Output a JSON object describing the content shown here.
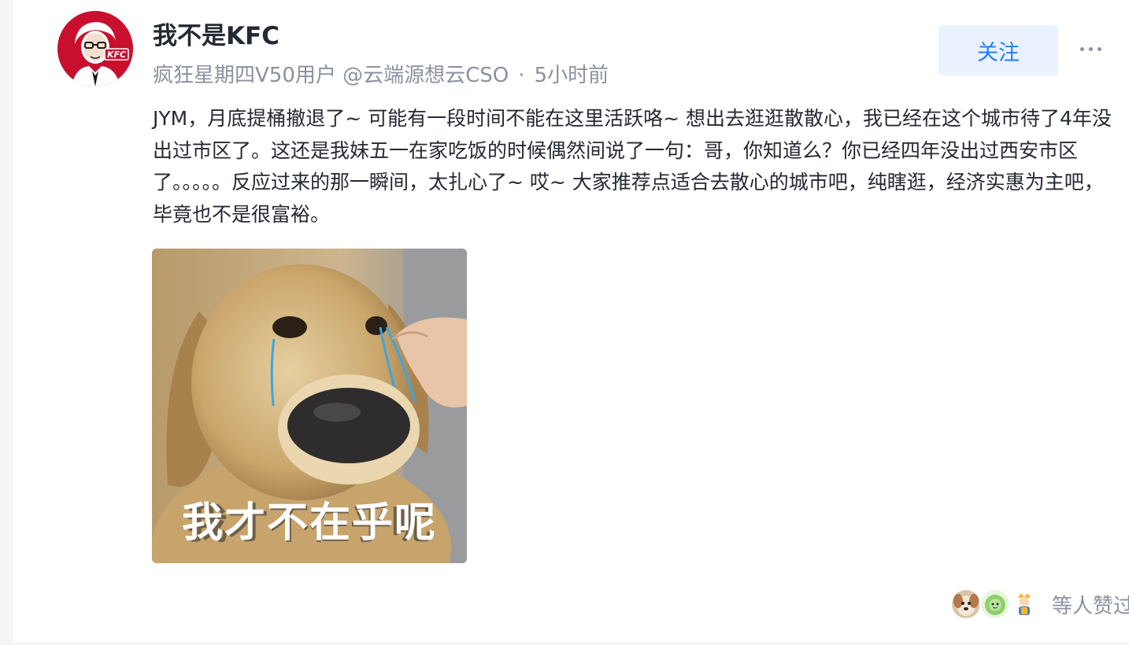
{
  "post": {
    "author": {
      "name": "我不是KFC",
      "avatar_icon": "kfc-logo-avatar",
      "avatar_text": "KFC",
      "title": "疯狂星期四V50用户 @云端源想云CSO",
      "time": "5小时前"
    },
    "follow_label": "关注",
    "more_icon": "more-dots-icon",
    "separator": "·",
    "content": "JYM，月底提桶撤退了~ 可能有一段时间不能在这里活跃咯~ 想出去逛逛散散心，我已经在这个城市待了4年没出过市区了。这还是我妹五一在家吃饭的时候偶然间说了一句：哥，你知道么？你已经四年没出过西安市区了。。。。。反应过来的那一瞬间，太扎心了~ 哎~ 大家推荐点适合去散心的城市吧，纯瞎逛，经济实惠为主吧，毕竟也不是很富裕。",
    "image": {
      "caption": "我才不在乎呢"
    },
    "likes_text": "等人赞过"
  },
  "colors": {
    "accent": "#1e80ff",
    "accent_bg": "#eaf2ff",
    "text_primary": "#252933",
    "text_secondary": "#8a919f",
    "kfc_red": "#c8102e"
  }
}
